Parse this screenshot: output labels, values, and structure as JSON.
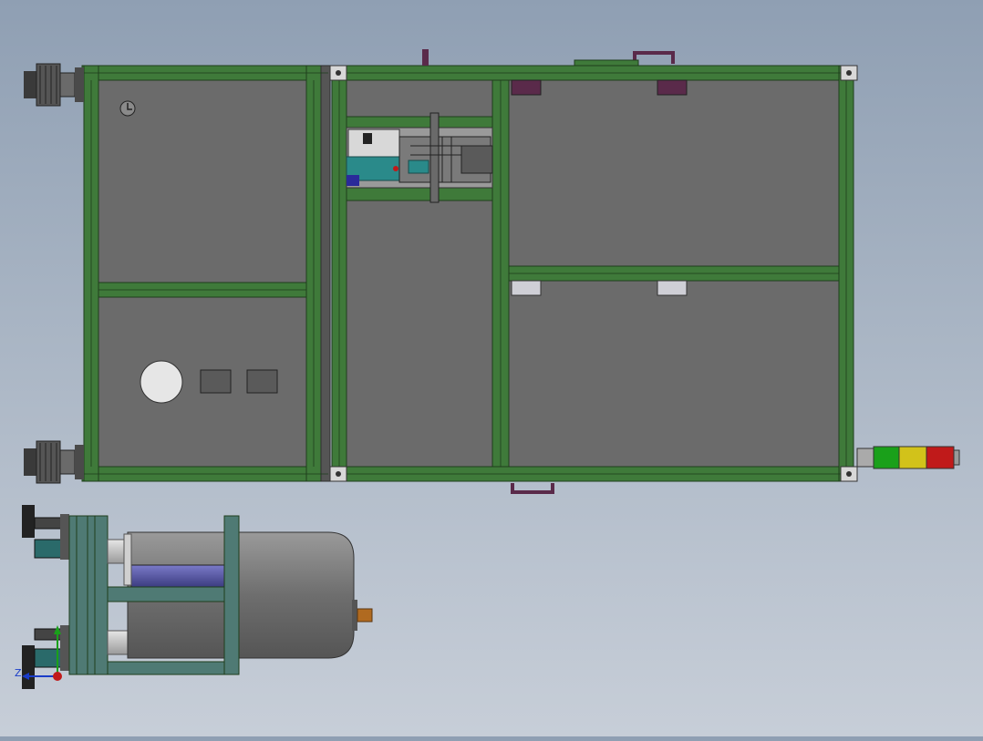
{
  "view": {
    "background_top": "#8f9fb3",
    "background_bottom": "#c7ced8"
  },
  "colors": {
    "frame_green": "#3f7a3a",
    "frame_dark": "#1f3d1c",
    "panel_gray": "#6b6b6b",
    "panel_edge": "#2e2e2e",
    "handle_purple": "#5a2a4a",
    "signal_green": "#1aa01a",
    "signal_yellow": "#d2c21a",
    "signal_red": "#c01a1a",
    "motor_gray": "#7a7a7a",
    "roller_purple": "#5a5aa0",
    "shaft_orange": "#b06a20",
    "teal": "#2a8a8a"
  },
  "triad": {
    "z_label": "Z",
    "icons": [
      "axis-y-icon",
      "axis-z-icon",
      "axis-x-icon"
    ]
  }
}
